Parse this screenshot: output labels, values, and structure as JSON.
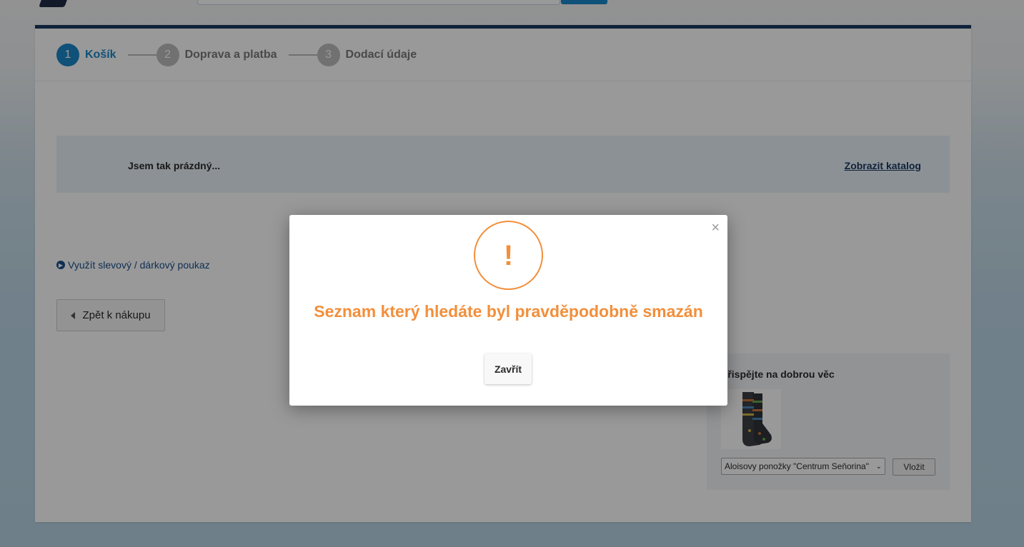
{
  "checkout_steps": [
    {
      "number": "1",
      "label": "Košík"
    },
    {
      "number": "2",
      "label": "Doprava a platba"
    },
    {
      "number": "3",
      "label": "Dodací údaje"
    }
  ],
  "cart": {
    "empty_message": "Jsem tak prázdný...",
    "catalog_link": "Zobrazit katalog",
    "voucher_link": "Využít slevový / dárkový poukaz",
    "back_button": "Zpět k nákupu"
  },
  "donation": {
    "title": "Přispějte na dobrou věc",
    "selected_product": "Aloisovy ponožky \"Centrum Seňorina\"",
    "insert_button": "Vložit"
  },
  "modal": {
    "close_symbol": "×",
    "warning_symbol": "!",
    "message": "Seznam který hledáte byl pravděpodobně smazán",
    "button": "Zavřít"
  },
  "colors": {
    "accent": "#1a87c9",
    "header_border": "#1a3a63",
    "warning": "#f28f3b"
  }
}
